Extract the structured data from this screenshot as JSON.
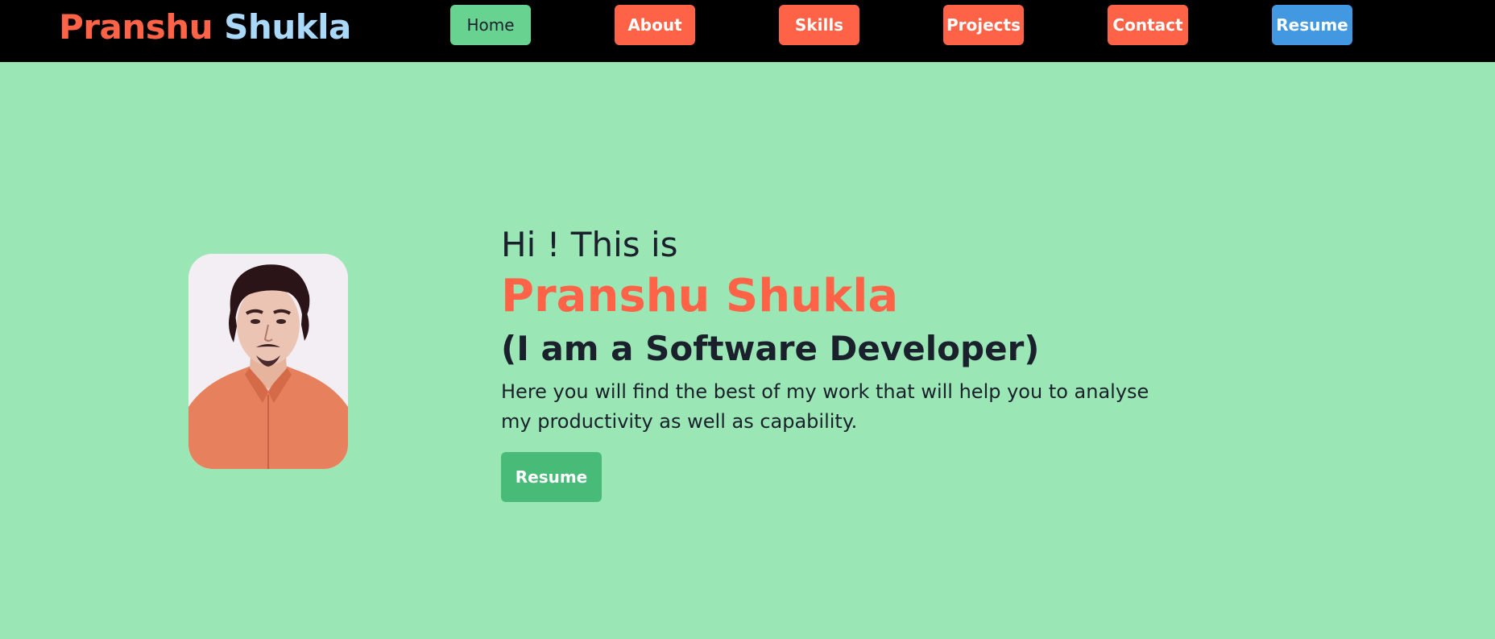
{
  "brand": {
    "first": "Pranshu",
    "last": "Shukla"
  },
  "nav": {
    "home": "Home",
    "about": "About",
    "skills": "Skills",
    "projects": "Projects",
    "contact": "Contact",
    "resume": "Resume"
  },
  "hero": {
    "greeting": "Hi ! This is",
    "name": "Pranshu Shukla",
    "role": "(I am a Software Developer)",
    "description": "Here you will find the best of my work that will help you to analyse my productivity as well as capability.",
    "cta_label": "Resume"
  },
  "colors": {
    "page_bg": "#9ae6b4",
    "navbar_bg": "#000000",
    "accent_tomato": "#ff6347",
    "brand_light_blue": "#a9d8f8",
    "home_button": "#68d391",
    "resume_nav_button": "#4299e1",
    "cta_button": "#48bb78",
    "text_dark": "#1a202c"
  }
}
